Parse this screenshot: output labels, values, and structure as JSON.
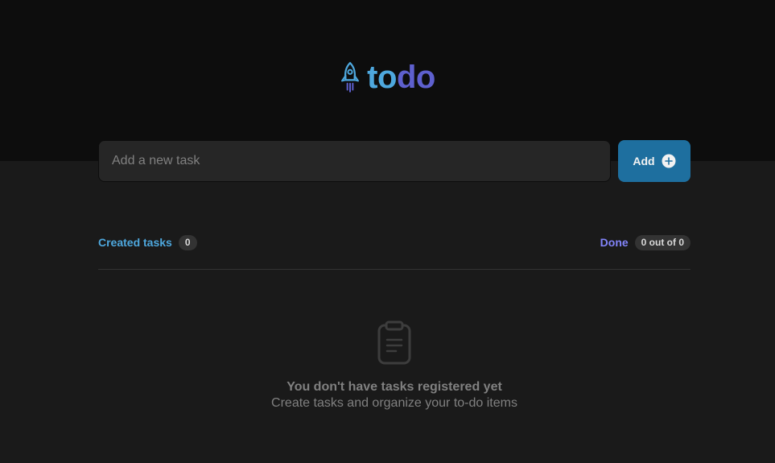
{
  "brand": {
    "icon": "rocket-icon",
    "title_part1": "to",
    "title_part2": "do",
    "color_part1": "#4ea8de",
    "color_part2": "#5e60ce"
  },
  "form": {
    "placeholder": "Add a new task",
    "value": "",
    "add_label": "Add",
    "add_icon": "plus-circle-icon"
  },
  "summary": {
    "created_label": "Created tasks",
    "created_count": "0",
    "done_label": "Done",
    "done_count": "0 out of 0"
  },
  "empty_state": {
    "icon": "clipboard-icon",
    "title": "You don't have tasks registered yet",
    "subtitle": "Create tasks and organize your to-do items"
  },
  "colors": {
    "header_bg": "#0d0d0d",
    "page_bg": "#1a1a1a",
    "accent_blue": "#4ea8de",
    "accent_purple": "#8284fa",
    "button_bg": "#1e6f9f"
  }
}
